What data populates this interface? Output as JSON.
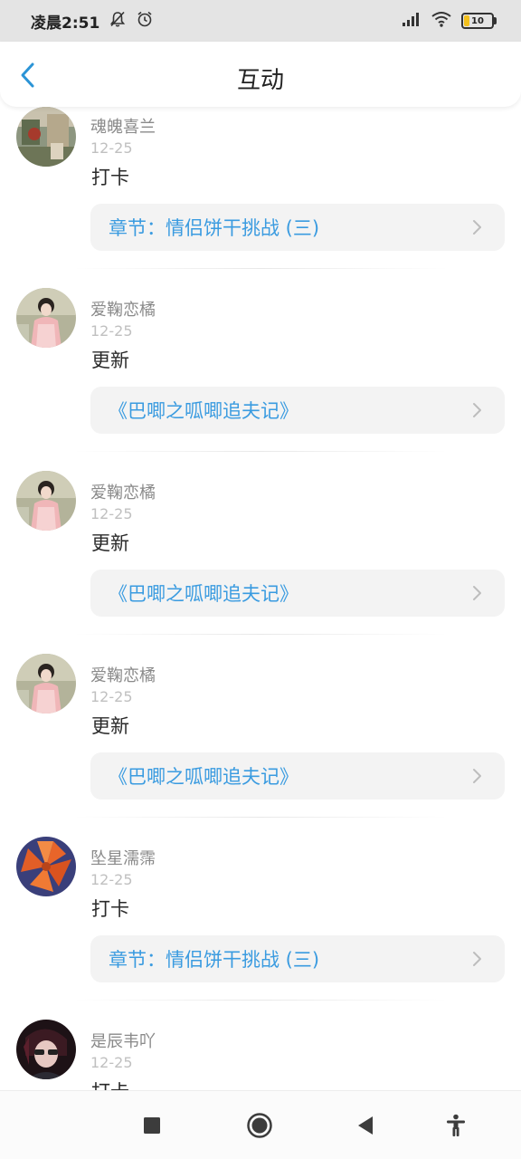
{
  "status_bar": {
    "time": "凌晨2:51",
    "battery_level": "10",
    "icons": [
      "bell-muted-icon",
      "alarm-icon",
      "signal-icon",
      "wifi-icon",
      "battery-icon"
    ]
  },
  "header": {
    "title": "互动",
    "back_icon": "chevron-left-icon"
  },
  "colors": {
    "accent": "#3a9be0",
    "back_icon": "#2b94d6",
    "card_bg": "#f3f3f3",
    "name_text": "#8a8a8a",
    "date_text": "#c0c0c0",
    "status_bar_bg": "#e4e4e4"
  },
  "feed": {
    "items": [
      {
        "user": "魂魄喜兰",
        "date": "12-25",
        "action": "打卡",
        "link": "章节：情侣饼干挑战 (三)",
        "avatar": "avatar-photo-icon"
      },
      {
        "user": "爱鞠恋橘",
        "date": "12-25",
        "action": "更新",
        "link": "《巴唧之呱唧追夫记》",
        "avatar": "avatar-photo-icon"
      },
      {
        "user": "爱鞠恋橘",
        "date": "12-25",
        "action": "更新",
        "link": "《巴唧之呱唧追夫记》",
        "avatar": "avatar-photo-icon"
      },
      {
        "user": "爱鞠恋橘",
        "date": "12-25",
        "action": "更新",
        "link": "《巴唧之呱唧追夫记》",
        "avatar": "avatar-photo-icon"
      },
      {
        "user": "坠星濡霈",
        "date": "12-25",
        "action": "打卡",
        "link": "章节：情侣饼干挑战 (三)",
        "avatar": "avatar-photo-icon"
      },
      {
        "user": "是辰韦吖",
        "date": "12-25",
        "action": "打卡",
        "link": "",
        "avatar": "avatar-photo-icon"
      }
    ]
  },
  "nav_bar": {
    "buttons": [
      "recents-square-icon",
      "home-circle-icon",
      "back-triangle-icon",
      "accessibility-icon"
    ]
  }
}
